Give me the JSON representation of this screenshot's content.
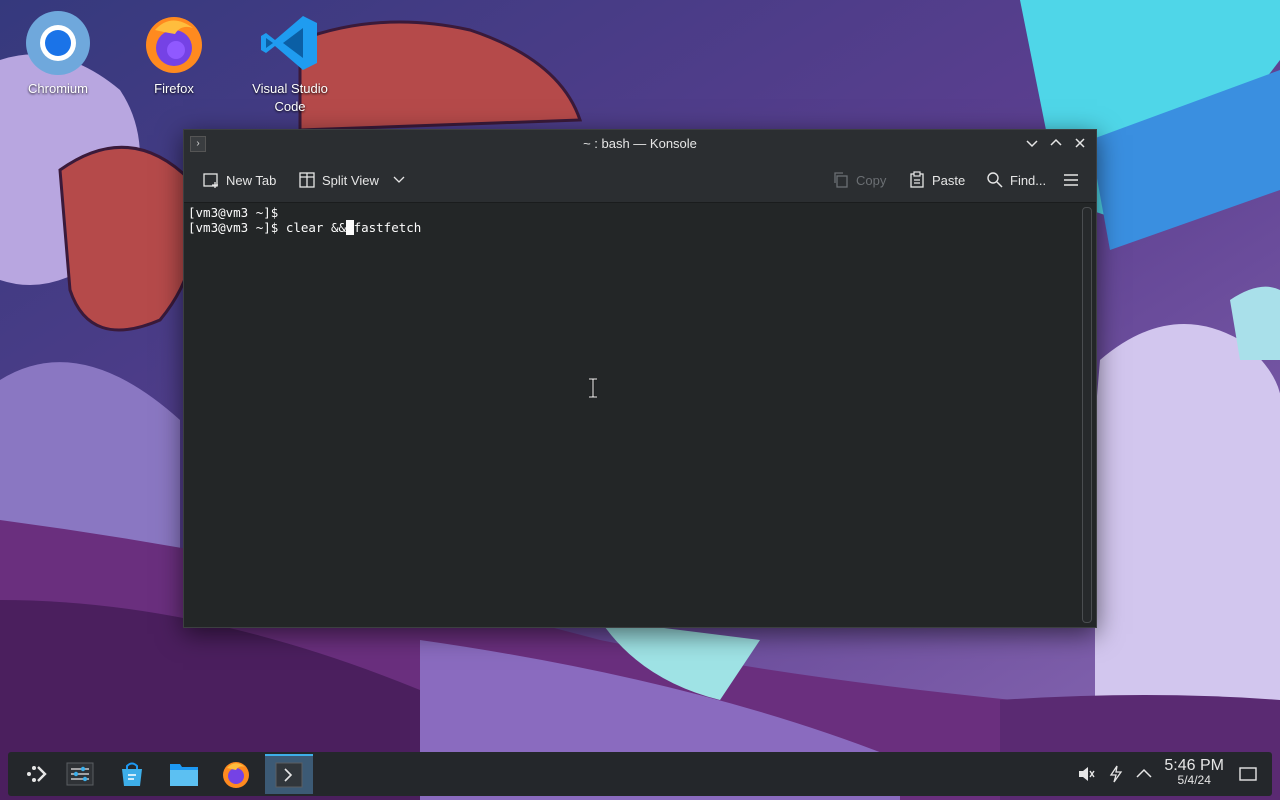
{
  "desktop": {
    "icons": [
      {
        "label": "Chromium"
      },
      {
        "label": "Firefox"
      },
      {
        "label": "Visual Studio Code"
      }
    ]
  },
  "window": {
    "title": "~ : bash — Konsole",
    "toolbar": {
      "new_tab": "New Tab",
      "split_view": "Split View",
      "copy": "Copy",
      "paste": "Paste",
      "find": "Find..."
    },
    "terminal": {
      "line1": "[vm3@vm3 ~]$",
      "line2_prefix": "[vm3@vm3 ~]$ clear &&",
      "line2_cursor": " ",
      "line2_suffix": "fastfetch"
    }
  },
  "taskbar": {
    "time": "5:46 PM",
    "date": "5/4/24"
  },
  "colors": {
    "accent": "#3daee9",
    "terminal_bg": "#232627",
    "terminal_fg": "#fcfcfc",
    "titlebar_bg": "#2b2e31",
    "taskbar_bg": "#24272b"
  }
}
